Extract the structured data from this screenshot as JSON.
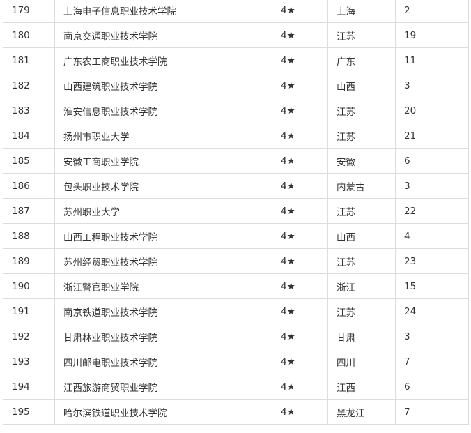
{
  "rows": [
    {
      "rank": "179",
      "name": "上海电子信息职业技术学院",
      "stars": "4★",
      "province": "上海",
      "count": "2"
    },
    {
      "rank": "180",
      "name": "南京交通职业技术学院",
      "stars": "4★",
      "province": "江苏",
      "count": "19"
    },
    {
      "rank": "181",
      "name": "广东农工商职业技术学院",
      "stars": "4★",
      "province": "广东",
      "count": "11"
    },
    {
      "rank": "182",
      "name": "山西建筑职业技术学院",
      "stars": "4★",
      "province": "山西",
      "count": "3"
    },
    {
      "rank": "183",
      "name": "淮安信息职业技术学院",
      "stars": "4★",
      "province": "江苏",
      "count": "20"
    },
    {
      "rank": "184",
      "name": "扬州市职业大学",
      "stars": "4★",
      "province": "江苏",
      "count": "21"
    },
    {
      "rank": "185",
      "name": "安徽工商职业学院",
      "stars": "4★",
      "province": "安徽",
      "count": "6"
    },
    {
      "rank": "186",
      "name": "包头职业技术学院",
      "stars": "4★",
      "province": "内蒙古",
      "count": "3"
    },
    {
      "rank": "187",
      "name": "苏州职业大学",
      "stars": "4★",
      "province": "江苏",
      "count": "22"
    },
    {
      "rank": "188",
      "name": "山西工程职业技术学院",
      "stars": "4★",
      "province": "山西",
      "count": "4"
    },
    {
      "rank": "189",
      "name": "苏州经贸职业技术学院",
      "stars": "4★",
      "province": "江苏",
      "count": "23"
    },
    {
      "rank": "190",
      "name": "浙江警官职业学院",
      "stars": "4★",
      "province": "浙江",
      "count": "15"
    },
    {
      "rank": "191",
      "name": "南京铁道职业技术学院",
      "stars": "4★",
      "province": "江苏",
      "count": "24"
    },
    {
      "rank": "192",
      "name": "甘肃林业职业技术学院",
      "stars": "4★",
      "province": "甘肃",
      "count": "3"
    },
    {
      "rank": "193",
      "name": "四川邮电职业技术学院",
      "stars": "4★",
      "province": "四川",
      "count": "7"
    },
    {
      "rank": "194",
      "name": "江西旅游商贸职业学院",
      "stars": "4★",
      "province": "江西",
      "count": "6"
    },
    {
      "rank": "195",
      "name": "哈尔滨铁道职业技术学院",
      "stars": "4★",
      "province": "黑龙江",
      "count": "7"
    }
  ]
}
